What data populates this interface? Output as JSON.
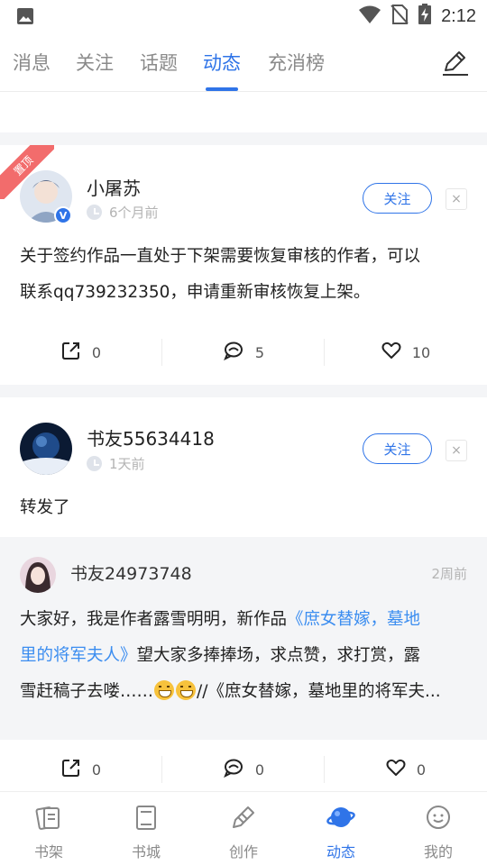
{
  "status_bar": {
    "time": "2:12"
  },
  "tabs": [
    {
      "label": "消息",
      "active": false
    },
    {
      "label": "关注",
      "active": false
    },
    {
      "label": "话题",
      "active": false
    },
    {
      "label": "动态",
      "active": true
    },
    {
      "label": "充消榜",
      "active": false
    }
  ],
  "posts": [
    {
      "pinned_label": "置顶",
      "username": "小屠苏",
      "time": "6个月前",
      "follow_label": "关注",
      "close_label": "×",
      "content_lines": [
        "关于签约作品一直处于下架需要恢复审核的作者，可以",
        "联系qq739232350，申请重新审核恢复上架。"
      ],
      "share_count": "0",
      "comment_count": "5",
      "like_count": "10"
    },
    {
      "username": "书友55634418",
      "time": "1天前",
      "follow_label": "关注",
      "close_label": "×",
      "content": "转发了",
      "repost": {
        "username": "书友24973748",
        "time": "2周前",
        "line1_prefix": "大家好，我是作者露雪明明，新作品",
        "line1_link": "《庶女替嫁，墓地",
        "line2_link": "里的将军夫人》",
        "line2_suffix": "望大家多捧捧场，求点赞，求打赏，露",
        "line3_prefix": "雪赶稿子去喽……",
        "line3_suffix": "//《庶女替嫁，墓地里的将军夫..."
      },
      "share_count": "0",
      "comment_count": "0",
      "like_count": "0"
    }
  ],
  "bottom_nav": [
    {
      "label": "书架",
      "icon": "bookshelf-icon",
      "active": false
    },
    {
      "label": "书城",
      "icon": "bookstore-icon",
      "active": false
    },
    {
      "label": "创作",
      "icon": "pen-icon",
      "active": false
    },
    {
      "label": "动态",
      "icon": "planet-icon",
      "active": true
    },
    {
      "label": "我的",
      "icon": "profile-face-icon",
      "active": false
    }
  ],
  "colors": {
    "accent": "#2f74e8",
    "link": "#3b8df0",
    "pinned": "#f26c6c",
    "muted": "#8a8a8a",
    "bg_gap": "#f4f5f7"
  }
}
